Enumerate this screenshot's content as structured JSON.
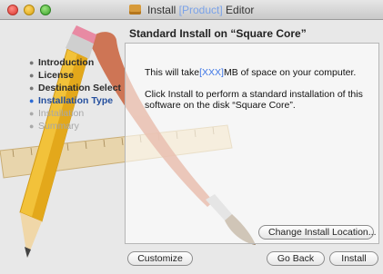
{
  "window": {
    "title_prefix": "Install",
    "title_product": "[Product]",
    "title_suffix": "Editor"
  },
  "header": {
    "title": "Standard Install on “Square Core”"
  },
  "steps": [
    {
      "label": "Introduction",
      "state": "done"
    },
    {
      "label": "License",
      "state": "done"
    },
    {
      "label": "Destination Select",
      "state": "done"
    },
    {
      "label": "Installation Type",
      "state": "current"
    },
    {
      "label": "Installation",
      "state": "pending"
    },
    {
      "label": "Summary",
      "state": "pending"
    }
  ],
  "content": {
    "space_prefix": "This will take",
    "space_value": "[XXX]",
    "space_suffix": "MB of space on your computer.",
    "instructions": "Click Install to perform a standard installation of this software on the disk “Square Core”."
  },
  "buttons": {
    "change_location": "Change Install Location...",
    "customize": "Customize",
    "go_back": "Go Back",
    "install": "Install"
  },
  "colors": {
    "accent": "#3e76e6",
    "product_text": "#7aa2e8"
  }
}
